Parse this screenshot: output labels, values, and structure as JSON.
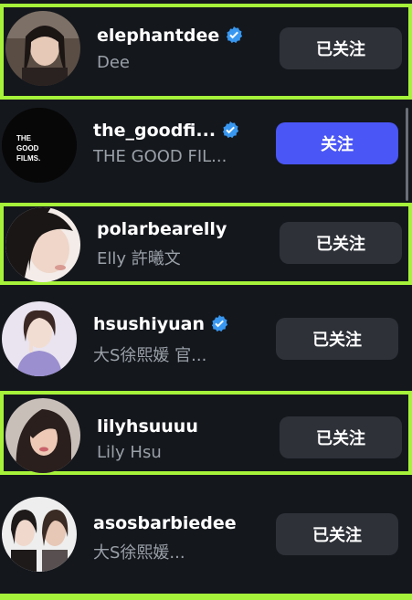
{
  "accounts": [
    {
      "username": "elephantdee",
      "subtitle": "Dee",
      "verified": true,
      "button": "已关注",
      "following": true
    },
    {
      "username": "the_goodfi...",
      "subtitle": "THE GOOD FIL...",
      "verified": true,
      "button": "关注",
      "following": false,
      "avatar_text": [
        "THE",
        "GOOD",
        "FILMS."
      ]
    },
    {
      "username": "polarbearelly",
      "subtitle": "Elly 許曦文",
      "verified": false,
      "button": "已关注",
      "following": true
    },
    {
      "username": "hsushiyuan",
      "subtitle": "大S徐熙媛  官...",
      "verified": true,
      "button": "已关注",
      "following": true
    },
    {
      "username": "lilyhsuuuu",
      "subtitle": "Lily Hsu",
      "verified": false,
      "button": "已关注",
      "following": true
    },
    {
      "username": "asosbarbiedee",
      "subtitle": "大S徐熙媛...",
      "verified": false,
      "button": "已关注",
      "following": true
    }
  ],
  "colors": {
    "background": "#14171c",
    "highlight_border": "#a6f23a",
    "button_following": "#2e3138",
    "button_follow": "#4a56f5",
    "verified_badge": "#3897f0"
  },
  "icons": {
    "verified": "verified-badge-icon"
  }
}
